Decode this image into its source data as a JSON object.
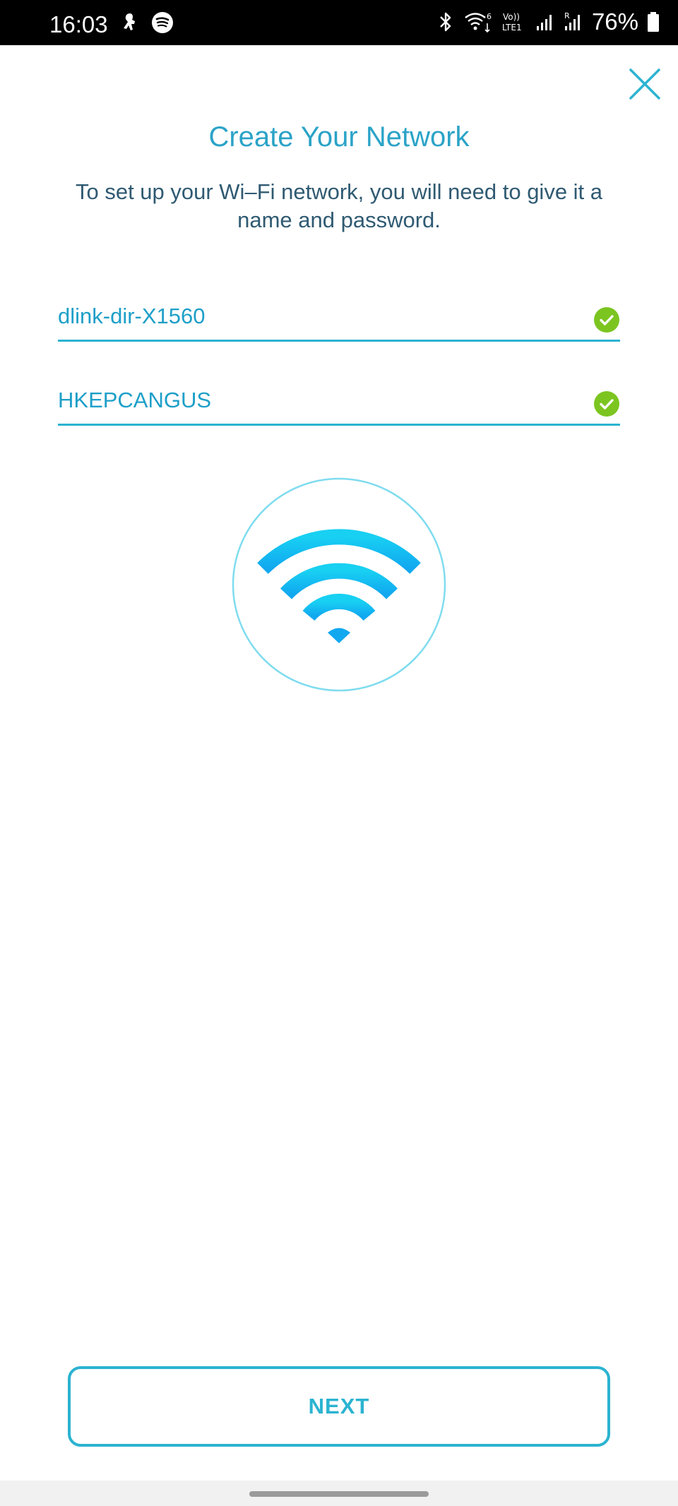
{
  "status_bar": {
    "time": "16:03",
    "battery": "76%",
    "left_icons": [
      "pin-icon",
      "spotify-icon"
    ],
    "right_icons": [
      "bluetooth-icon",
      "wifi-6-icon",
      "volte-lte1-icon",
      "signal-icon",
      "roaming-signal-icon",
      "battery-icon"
    ]
  },
  "header": {
    "close_icon": "close-icon",
    "title": "Create Your Network",
    "description": "To set up your Wi–Fi network, you will need to give it a name and password."
  },
  "form": {
    "ssid": {
      "value": "dlink-dir-X1560",
      "status_icon": "check-circle-icon"
    },
    "password": {
      "value": "HKEPCANGUS",
      "status_icon": "check-circle-icon"
    }
  },
  "illustration": {
    "icon": "wifi-icon"
  },
  "footer": {
    "next_label": "NEXT"
  },
  "colors": {
    "accent": "#2bb3d1",
    "title": "#2ba3c7",
    "description": "#2f5a72",
    "success": "#7cc521",
    "wifi": "#16c1ef"
  }
}
